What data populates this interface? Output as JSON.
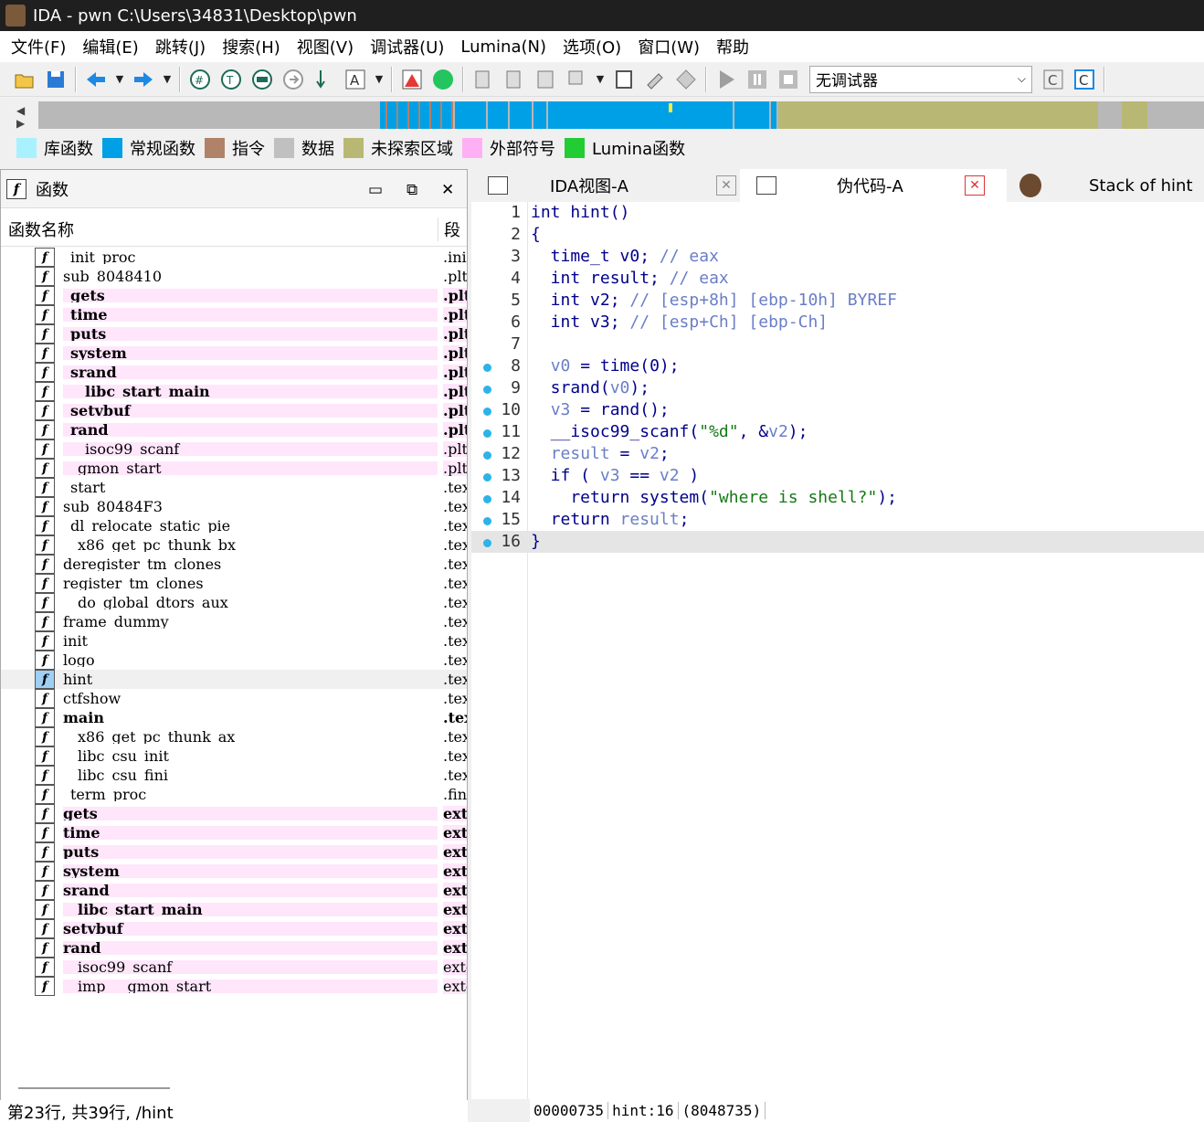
{
  "window": {
    "title": "IDA - pwn C:\\Users\\34831\\Desktop\\pwn"
  },
  "menu": [
    "文件(F)",
    "编辑(E)",
    "跳转(J)",
    "搜索(H)",
    "视图(V)",
    "调试器(U)",
    "Lumina(N)",
    "选项(O)",
    "窗口(W)",
    "帮助"
  ],
  "toolbar": {
    "debugger_select": "无调试器"
  },
  "legend": [
    {
      "label": "库函数",
      "color": "#a8f2ff"
    },
    {
      "label": "常规函数",
      "color": "#00a0e6"
    },
    {
      "label": "指令",
      "color": "#b0826a"
    },
    {
      "label": "数据",
      "color": "#c0c0c0"
    },
    {
      "label": "未探索区域",
      "color": "#b8b874"
    },
    {
      "label": "外部符号",
      "color": "#ffb0f5"
    },
    {
      "label": "Lumina函数",
      "color": "#22cc33"
    }
  ],
  "functions_panel": {
    "title": "函数",
    "col_name": "函数名称",
    "col_segment": "段",
    "rows": [
      {
        "name": "_init_proc",
        "seg": ".init",
        "style": ""
      },
      {
        "name": "sub_8048410",
        "seg": ".plt",
        "style": ""
      },
      {
        "name": "_gets",
        "seg": ".plt",
        "style": "pink bold"
      },
      {
        "name": "_time",
        "seg": ".plt",
        "style": "pink bold"
      },
      {
        "name": "_puts",
        "seg": ".plt",
        "style": "pink bold"
      },
      {
        "name": "_system",
        "seg": ".plt",
        "style": "pink bold"
      },
      {
        "name": "_srand",
        "seg": ".plt",
        "style": "pink bold"
      },
      {
        "name": "___libc_start_main",
        "seg": ".plt",
        "style": "pink bold"
      },
      {
        "name": "_setvbuf",
        "seg": ".plt",
        "style": "pink bold"
      },
      {
        "name": "_rand",
        "seg": ".plt",
        "style": "pink bold"
      },
      {
        "name": "___isoc99_scanf",
        "seg": ".plt",
        "style": "pink"
      },
      {
        "name": "__gmon_start__",
        "seg": ".plt",
        "style": "pink"
      },
      {
        "name": "_start",
        "seg": ".text",
        "style": ""
      },
      {
        "name": "sub_80484F3",
        "seg": ".text",
        "style": ""
      },
      {
        "name": "_dl_relocate_static_pie",
        "seg": ".text",
        "style": ""
      },
      {
        "name": "__x86_get_pc_thunk_bx",
        "seg": ".text",
        "style": ""
      },
      {
        "name": "deregister_tm_clones",
        "seg": ".text",
        "style": ""
      },
      {
        "name": "register_tm_clones",
        "seg": ".text",
        "style": ""
      },
      {
        "name": "__do_global_dtors_aux",
        "seg": ".text",
        "style": ""
      },
      {
        "name": "frame_dummy",
        "seg": ".text",
        "style": ""
      },
      {
        "name": "init",
        "seg": ".text",
        "style": ""
      },
      {
        "name": "logo",
        "seg": ".text",
        "style": ""
      },
      {
        "name": "hint",
        "seg": ".text",
        "style": "sel"
      },
      {
        "name": "ctfshow",
        "seg": ".text",
        "style": ""
      },
      {
        "name": "main",
        "seg": ".text",
        "style": "bold"
      },
      {
        "name": "__x86_get_pc_thunk_ax",
        "seg": ".text",
        "style": ""
      },
      {
        "name": "__libc_csu_init",
        "seg": ".text",
        "style": ""
      },
      {
        "name": "__libc_csu_fini",
        "seg": ".text",
        "style": ""
      },
      {
        "name": "_term_proc",
        "seg": ".fini",
        "style": ""
      },
      {
        "name": "gets",
        "seg": "extern",
        "style": "pink bold"
      },
      {
        "name": "time",
        "seg": "extern",
        "style": "pink bold"
      },
      {
        "name": "puts",
        "seg": "extern",
        "style": "pink bold"
      },
      {
        "name": "system",
        "seg": "extern",
        "style": "pink bold"
      },
      {
        "name": "srand",
        "seg": "extern",
        "style": "pink bold"
      },
      {
        "name": "__libc_start_main",
        "seg": "extern",
        "style": "pink bold"
      },
      {
        "name": "setvbuf",
        "seg": "extern",
        "style": "pink bold"
      },
      {
        "name": "rand",
        "seg": "extern",
        "style": "pink bold"
      },
      {
        "name": "__isoc99_scanf",
        "seg": "extern",
        "style": "pink"
      },
      {
        "name": "__imp___gmon_start__",
        "seg": "extern",
        "style": "pink"
      }
    ],
    "status": "第23行, 共39行, /hint"
  },
  "tabs": [
    {
      "label": "IDA视图-A"
    },
    {
      "label": "伪代码-A"
    },
    {
      "label": "Stack of hint"
    }
  ],
  "pseudocode": {
    "lines": [
      {
        "n": "1",
        "dot": false,
        "html": "int hint()"
      },
      {
        "n": "2",
        "dot": false,
        "html": "{"
      },
      {
        "n": "3",
        "dot": false,
        "html": "  time_t v0; <span class=\"c-cm\">// eax</span>"
      },
      {
        "n": "4",
        "dot": false,
        "html": "  int result; <span class=\"c-cm\">// eax</span>"
      },
      {
        "n": "5",
        "dot": false,
        "html": "  int v2; <span class=\"c-cm\">// [esp+8h] [ebp-10h] BYREF</span>"
      },
      {
        "n": "6",
        "dot": false,
        "html": "  int v3; <span class=\"c-cm\">// [esp+Ch] [ebp-Ch]</span>"
      },
      {
        "n": "7",
        "dot": false,
        "html": ""
      },
      {
        "n": "8",
        "dot": true,
        "html": "  <span class=\"c-var\">v0</span> = time(0);"
      },
      {
        "n": "9",
        "dot": true,
        "html": "  srand(<span class=\"c-var\">v0</span>);"
      },
      {
        "n": "10",
        "dot": true,
        "html": "  <span class=\"c-var\">v3</span> = rand();"
      },
      {
        "n": "11",
        "dot": true,
        "html": "  __isoc99_scanf(<span class=\"c-str\">\"%d\"</span>, &amp;<span class=\"c-var\">v2</span>);"
      },
      {
        "n": "12",
        "dot": true,
        "html": "  <span class=\"c-var\">result</span> = <span class=\"c-var\">v2</span>;"
      },
      {
        "n": "13",
        "dot": true,
        "html": "  if ( <span class=\"c-var\">v3</span> == <span class=\"c-var\">v2</span> )"
      },
      {
        "n": "14",
        "dot": true,
        "html": "    return system(<span class=\"c-str\">\"where is shell?\"</span>);"
      },
      {
        "n": "15",
        "dot": true,
        "html": "  return <span class=\"c-var\">result</span>;"
      },
      {
        "n": "16",
        "dot": true,
        "html": "}"
      }
    ],
    "status": {
      "address": "00000735",
      "location": "hint:16",
      "ea": "(8048735)"
    }
  }
}
